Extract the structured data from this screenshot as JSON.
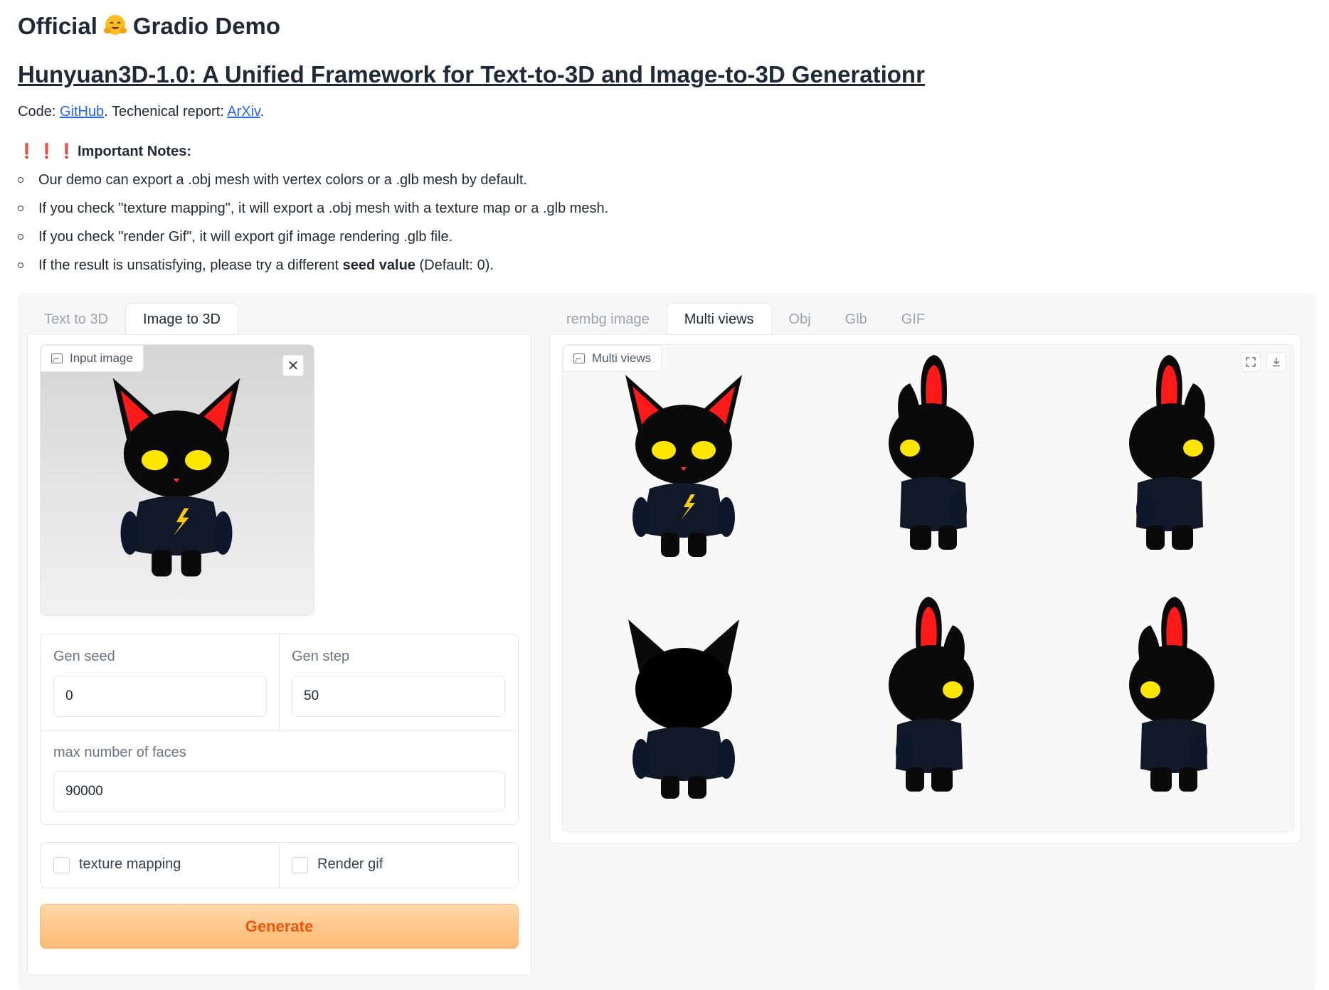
{
  "header": {
    "title_before_emoji": "Official",
    "title_after_emoji": "Gradio Demo",
    "subtitle_link": "Hunyuan3D-1.0: A Unified Framework for Text-to-3D and Image-to-3D Generationr",
    "code_prefix": "Code: ",
    "github_link": "GitHub",
    "report_prefix": ". Techenical report: ",
    "arxiv_link": "ArXiv",
    "report_suffix": "."
  },
  "notes": {
    "bangs": [
      "❗",
      "❗",
      "❗"
    ],
    "heading": "Important Notes:",
    "item1": "Our demo can export a .obj mesh with vertex colors or a .glb mesh by default.",
    "item2": "If you check \"texture mapping\", it will export a .obj mesh with a texture map or a .glb mesh.",
    "item3": "If you check \"render Gif\", it will export gif image rendering .glb file.",
    "item4_before": "If the result is unsatisfying, please try a different ",
    "item4_bold": "seed value",
    "item4_after": " (Default: 0)."
  },
  "left_tabs": [
    "Text to 3D",
    "Image to 3D"
  ],
  "left_active_tab": "Image to 3D",
  "input_image": {
    "label": "Input image",
    "icon": "image-icon",
    "close_icon": "close-icon"
  },
  "gen_seed": {
    "label": "Gen seed",
    "value": "0"
  },
  "gen_step": {
    "label": "Gen step",
    "value": "50"
  },
  "max_faces": {
    "label": "max number of faces",
    "value": "90000"
  },
  "texture_mapping": {
    "label": "texture mapping",
    "checked": false
  },
  "render_gif": {
    "label": "Render gif",
    "checked": false
  },
  "generate_label": "Generate",
  "right_tabs": [
    "rembg image",
    "Multi views",
    "Obj",
    "Glb",
    "GIF"
  ],
  "right_active_tab": "Multi views",
  "multi_views": {
    "label": "Multi views",
    "icon": "image-icon",
    "actions": [
      "fullscreen-icon",
      "download-icon"
    ]
  },
  "colors": {
    "accent": "#ea580c",
    "generate_bg": "#fdba74",
    "link": "#2563eb",
    "warn": "#e11d48"
  }
}
